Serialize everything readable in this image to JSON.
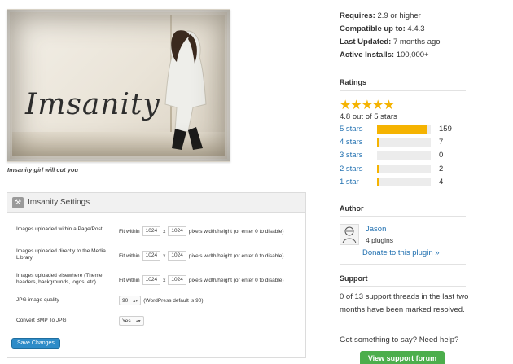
{
  "banner": {
    "logo_text": "Imsanity",
    "caption": "Imsanity girl will cut you"
  },
  "settings": {
    "title": "Imsanity Settings",
    "rows": [
      {
        "label": "Images uploaded within a Page/Post",
        "prefix": "Fit within",
        "width": "1024",
        "x": "x",
        "height": "1024",
        "suffix": "pixels width/height (or enter 0 to disable)"
      },
      {
        "label": "Images uploaded directly to the Media Library",
        "prefix": "Fit within",
        "width": "1024",
        "x": "x",
        "height": "1024",
        "suffix": "pixels width/height (or enter 0 to disable)"
      },
      {
        "label": "Images uploaded elsewhere (Theme headers, backgrounds, logos, etc)",
        "prefix": "Fit within",
        "width": "1024",
        "x": "x",
        "height": "1024",
        "suffix": "pixels width/height (or enter 0 to disable)"
      }
    ],
    "quality": {
      "label": "JPG image quality",
      "value": "90",
      "note": "(WordPress default is 90)"
    },
    "bmp": {
      "label": "Convert BMP To JPG",
      "value": "Yes"
    },
    "save_label": "Save Changes"
  },
  "meta": {
    "requires_label": "Requires:",
    "requires_value": "2.9 or higher",
    "compatible_label": "Compatible up to:",
    "compatible_value": "4.4.3",
    "updated_label": "Last Updated:",
    "updated_value": "7 months ago",
    "installs_label": "Active Installs:",
    "installs_value": "100,000+"
  },
  "ratings": {
    "title": "Ratings",
    "stars_glyph": "★★★★★",
    "average": "4.8 out of 5 stars",
    "rows": [
      {
        "label": "5 stars",
        "count": "159",
        "fraction": 0.93
      },
      {
        "label": "4 stars",
        "count": "7",
        "fraction": 0.04
      },
      {
        "label": "3 stars",
        "count": "0",
        "fraction": 0.0
      },
      {
        "label": "2 stars",
        "count": "2",
        "fraction": 0.012
      },
      {
        "label": "1 star",
        "count": "4",
        "fraction": 0.025
      }
    ],
    "star_color": "#f5b301"
  },
  "author": {
    "title": "Author",
    "name": "Jason",
    "plugins": "4 plugins",
    "donate": "Donate to this plugin »"
  },
  "support": {
    "title": "Support",
    "text": "0 of 13 support threads in the last two months have been marked resolved.",
    "question": "Got something to say? Need help?",
    "button": "View support forum",
    "button_color": "#4cae4c"
  }
}
